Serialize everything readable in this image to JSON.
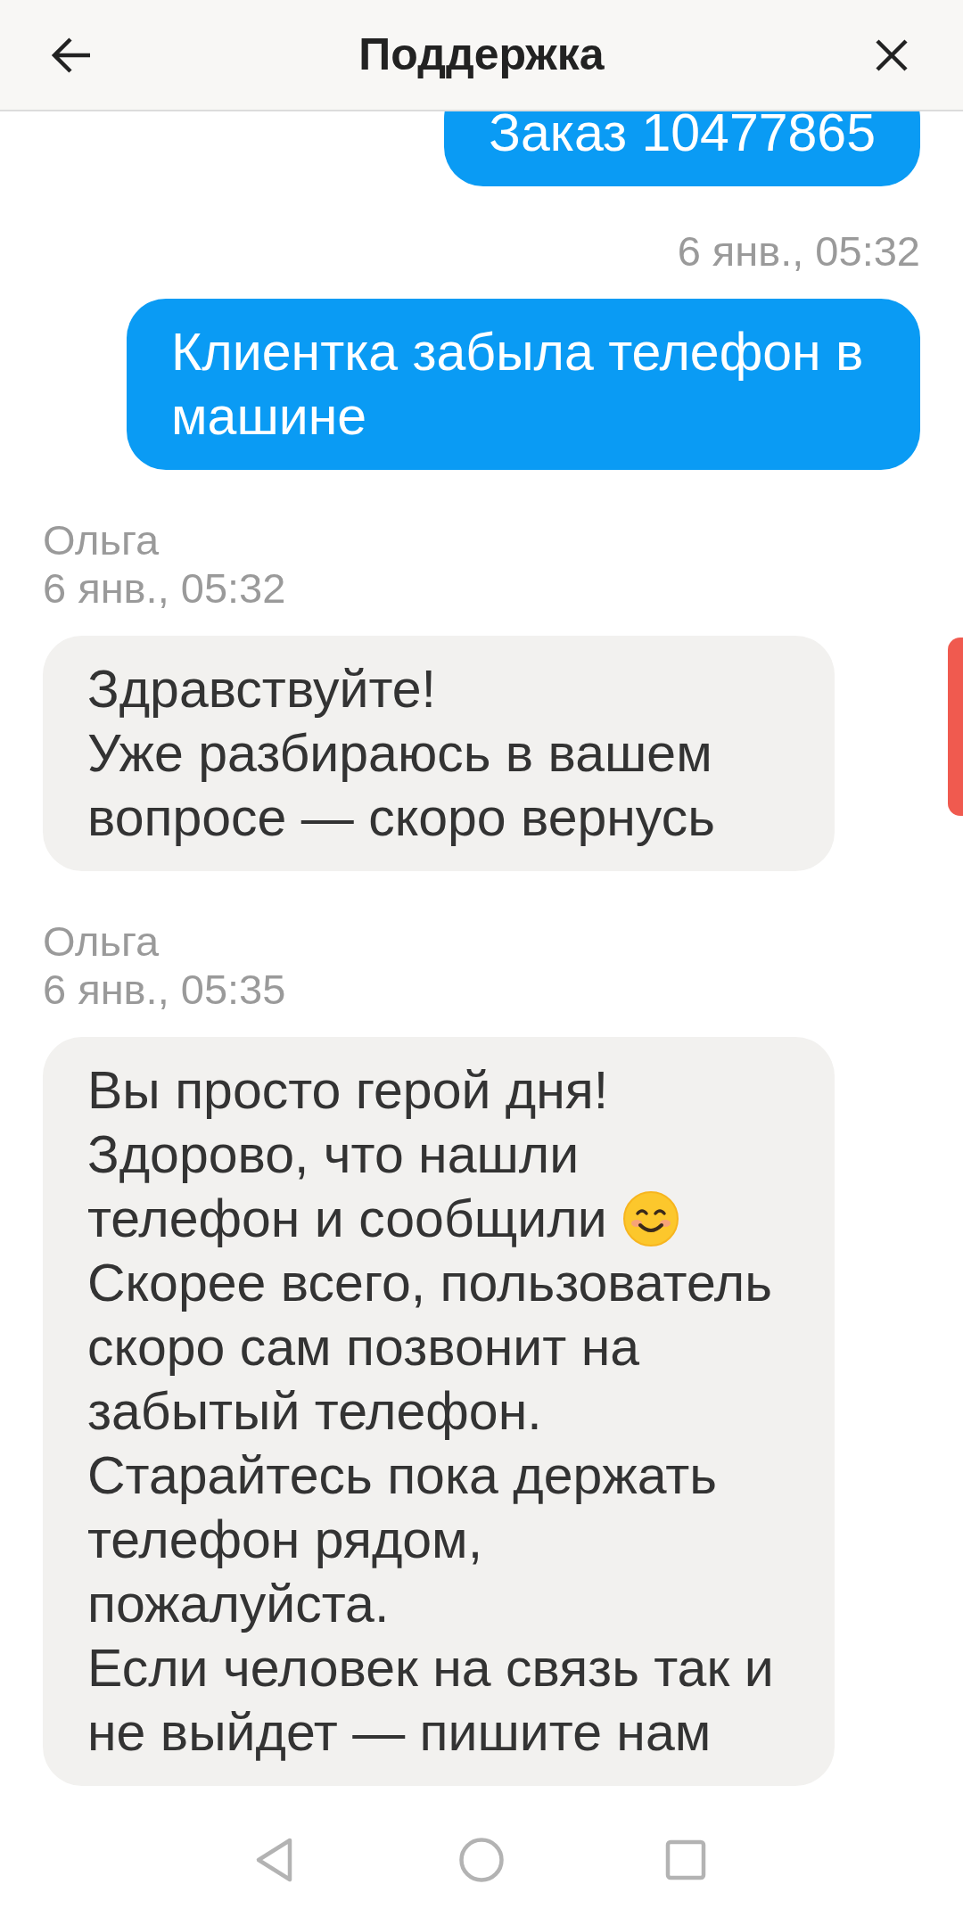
{
  "header": {
    "title": "Поддержка"
  },
  "messages": [
    {
      "kind": "outgoing",
      "parts": [
        {
          "kind": "text",
          "text": "Заказ 10477865"
        }
      ]
    },
    {
      "kind": "timestamp",
      "text": "6 янв., 05:32"
    },
    {
      "kind": "outgoing",
      "parts": [
        {
          "kind": "text",
          "text": "Клиентка забыла телефон в машине"
        }
      ]
    },
    {
      "kind": "incoming",
      "author": "Ольга",
      "time": "6 янв., 05:32",
      "parts": [
        {
          "kind": "text",
          "text": "Здравствуйте!\nУже разбираюсь в вашем вопросе — скоро вернусь"
        }
      ]
    },
    {
      "kind": "incoming",
      "author": "Ольга",
      "time": "6 янв., 05:35",
      "parts": [
        {
          "kind": "text",
          "text": "Вы просто герой дня!\nЗдорово, что нашли"
        },
        {
          "kind": "line",
          "text": "телефон и сообщили",
          "emoji": true
        },
        {
          "kind": "text",
          "text": "Скорее всего, пользователь скоро сам позвонит на забытый телефон. Старайтесь пока держать телефон рядом, пожалуйста.\nЕсли человек на связь так и не выйдет — пишите нам"
        }
      ]
    }
  ]
}
